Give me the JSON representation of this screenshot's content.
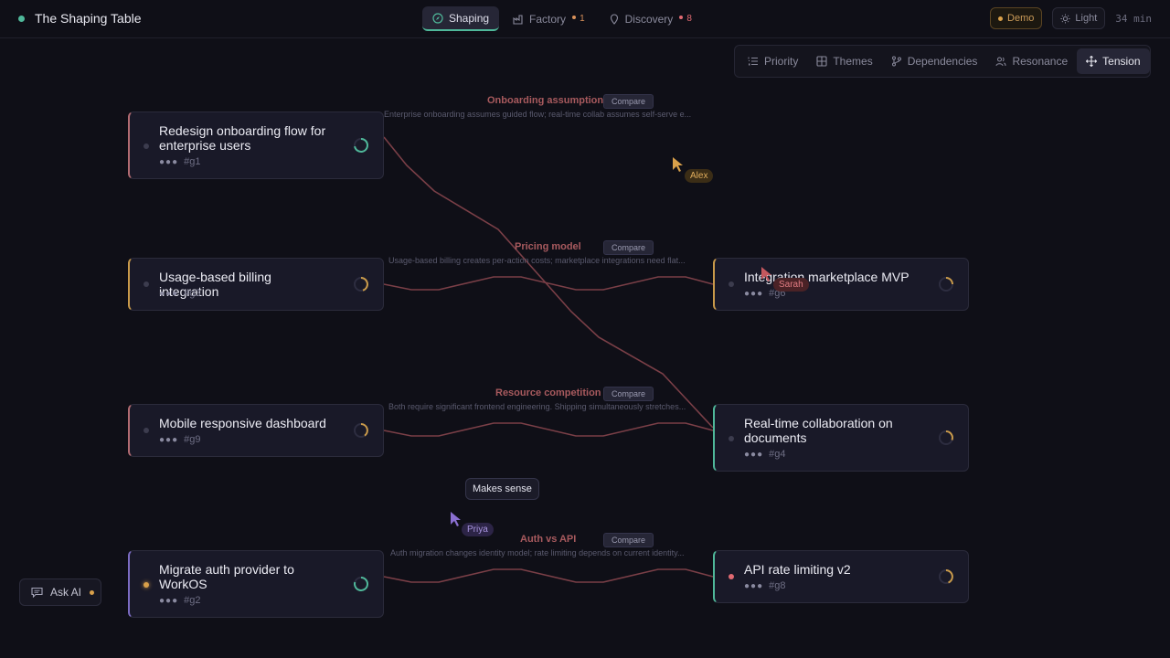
{
  "app": {
    "title": "The Shaping Table"
  },
  "modes": [
    {
      "label": "Shaping",
      "icon": "compass-icon",
      "active": true
    },
    {
      "label": "Factory",
      "icon": "factory-icon",
      "count": "1"
    },
    {
      "label": "Discovery",
      "icon": "pin-icon",
      "count": "8"
    }
  ],
  "top_right": {
    "demo_label": "Demo",
    "theme_label": "Light",
    "timer": "34 min"
  },
  "views": [
    {
      "label": "Priority",
      "icon": "list-ordered-icon"
    },
    {
      "label": "Themes",
      "icon": "grid-icon"
    },
    {
      "label": "Dependencies",
      "icon": "branch-icon"
    },
    {
      "label": "Resonance",
      "icon": "people-icon"
    },
    {
      "label": "Tension",
      "icon": "move-icon",
      "active": true
    }
  ],
  "cards": [
    {
      "id": "g1",
      "title": "Redesign onboarding flow for enterprise users",
      "tag": "#g1",
      "accent": "#b26b72"
    },
    {
      "id": "g3",
      "title": "Usage-based billing integration",
      "tag": "#g3",
      "accent": "#c99a4a"
    },
    {
      "id": "g9",
      "title": "Mobile responsive dashboard",
      "tag": "#g9",
      "accent": "#b26b72"
    },
    {
      "id": "g2",
      "title": "Migrate auth provider to WorkOS",
      "tag": "#g2",
      "accent": "#7b6bc2"
    },
    {
      "id": "g6",
      "title": "Integration marketplace MVP",
      "tag": "#g6",
      "accent": "#c99a4a"
    },
    {
      "id": "g4",
      "title": "Real-time collaboration on documents",
      "tag": "#g4",
      "accent": "#4fb89a"
    },
    {
      "id": "g8",
      "title": "API rate limiting v2",
      "tag": "#g8",
      "accent": "#4fb89a"
    }
  ],
  "tensions": [
    {
      "label": "Onboarding assumption",
      "compare": "Compare",
      "description": "Enterprise onboarding assumes guided flow; real-time collab assumes self-serve e..."
    },
    {
      "label": "Pricing model",
      "compare": "Compare",
      "description": "Usage-based billing creates per-action costs; marketplace integrations need flat..."
    },
    {
      "label": "Resource competition",
      "compare": "Compare",
      "description": "Both require significant frontend engineering. Shipping simultaneously stretches..."
    },
    {
      "label": "Auth vs API",
      "compare": "Compare",
      "description": "Auth migration changes identity model; rate limiting depends on current identity..."
    }
  ],
  "cursors": [
    {
      "name": "Alex",
      "color": "#d9a04a"
    },
    {
      "name": "Sarah",
      "color": "#c4585e"
    },
    {
      "name": "Priya",
      "color": "#8a6fd0"
    }
  ],
  "comment": {
    "text": "Makes sense"
  },
  "ask_ai": {
    "label": "Ask AI"
  }
}
